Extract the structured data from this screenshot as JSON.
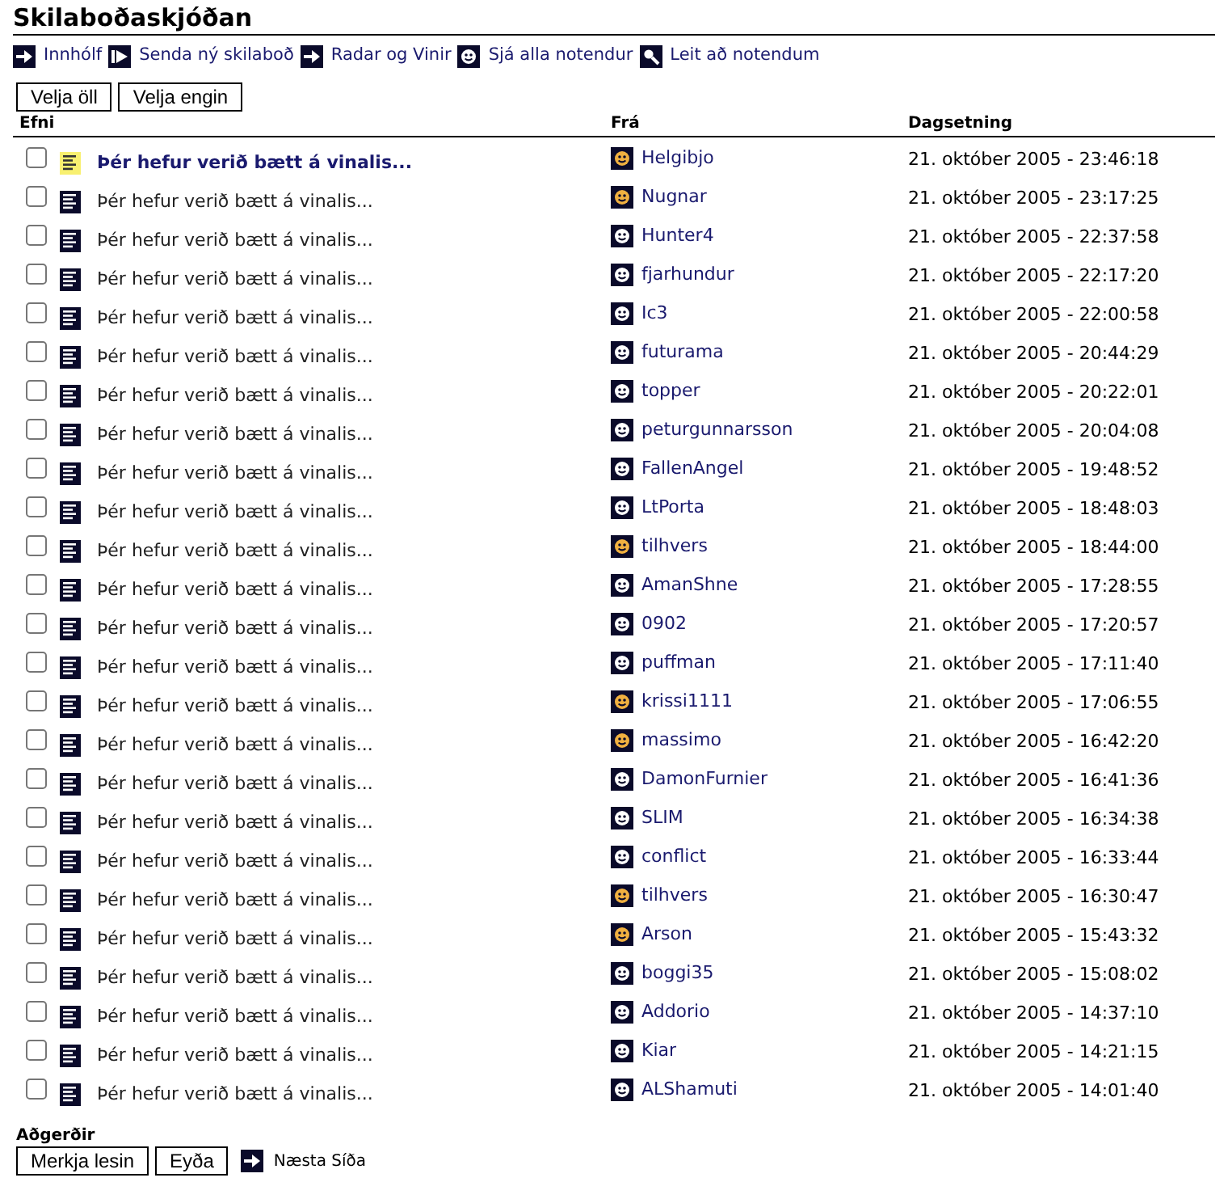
{
  "title": "Skilaboðaskjóðan",
  "nav": [
    {
      "kind": "arrow",
      "label": "Innhólf"
    },
    {
      "kind": "send",
      "label": "Senda ný skilaboð"
    },
    {
      "kind": "arrow",
      "label": "Radar og Vinir"
    },
    {
      "kind": "user",
      "label": "Sjá alla notendur"
    },
    {
      "kind": "search",
      "label": "Leit að notendum"
    }
  ],
  "select_buttons": [
    "Velja öll",
    "Velja engin"
  ],
  "columns": [
    "Efni",
    "Frá",
    "Dagsetning"
  ],
  "rows": [
    {
      "checked": false,
      "unread": true,
      "subject": "Þér hefur verið bætt á vinalis...",
      "from": "Helgibjo",
      "online": true,
      "date": "21. október 2005 - 23:46:18"
    },
    {
      "checked": false,
      "unread": false,
      "subject": "Þér hefur verið bætt á vinalis...",
      "from": "Nugnar",
      "online": true,
      "date": "21. október 2005 - 23:17:25"
    },
    {
      "checked": false,
      "unread": false,
      "subject": "Þér hefur verið bætt á vinalis...",
      "from": "Hunter4",
      "online": false,
      "date": "21. október 2005 - 22:37:58"
    },
    {
      "checked": false,
      "unread": false,
      "subject": "Þér hefur verið bætt á vinalis...",
      "from": "fjarhundur",
      "online": false,
      "date": "21. október 2005 - 22:17:20"
    },
    {
      "checked": false,
      "unread": false,
      "subject": "Þér hefur verið bætt á vinalis...",
      "from": "Ic3",
      "online": false,
      "date": "21. október 2005 - 22:00:58"
    },
    {
      "checked": false,
      "unread": false,
      "subject": "Þér hefur verið bætt á vinalis...",
      "from": "futurama",
      "online": false,
      "date": "21. október 2005 - 20:44:29"
    },
    {
      "checked": false,
      "unread": false,
      "subject": "Þér hefur verið bætt á vinalis...",
      "from": "topper",
      "online": false,
      "date": "21. október 2005 - 20:22:01"
    },
    {
      "checked": false,
      "unread": false,
      "subject": "Þér hefur verið bætt á vinalis...",
      "from": "peturgunnarsson",
      "online": false,
      "date": "21. október 2005 - 20:04:08"
    },
    {
      "checked": false,
      "unread": false,
      "subject": "Þér hefur verið bætt á vinalis...",
      "from": "FallenAngel",
      "online": false,
      "date": "21. október 2005 - 19:48:52"
    },
    {
      "checked": false,
      "unread": false,
      "subject": "Þér hefur verið bætt á vinalis...",
      "from": "LtPorta",
      "online": false,
      "date": "21. október 2005 - 18:48:03"
    },
    {
      "checked": false,
      "unread": false,
      "subject": "Þér hefur verið bætt á vinalis...",
      "from": "tilhvers",
      "online": true,
      "date": "21. október 2005 - 18:44:00"
    },
    {
      "checked": false,
      "unread": false,
      "subject": "Þér hefur verið bætt á vinalis...",
      "from": "AmanShne",
      "online": false,
      "date": "21. október 2005 - 17:28:55"
    },
    {
      "checked": false,
      "unread": false,
      "subject": "Þér hefur verið bætt á vinalis...",
      "from": "0902",
      "online": false,
      "date": "21. október 2005 - 17:20:57"
    },
    {
      "checked": false,
      "unread": false,
      "subject": "Þér hefur verið bætt á vinalis...",
      "from": "puffman",
      "online": false,
      "date": "21. október 2005 - 17:11:40"
    },
    {
      "checked": false,
      "unread": false,
      "subject": "Þér hefur verið bætt á vinalis...",
      "from": "krissi1111",
      "online": true,
      "date": "21. október 2005 - 17:06:55"
    },
    {
      "checked": false,
      "unread": false,
      "subject": "Þér hefur verið bætt á vinalis...",
      "from": "massimo",
      "online": true,
      "date": "21. október 2005 - 16:42:20"
    },
    {
      "checked": false,
      "unread": false,
      "subject": "Þér hefur verið bætt á vinalis...",
      "from": "DamonFurnier",
      "online": false,
      "date": "21. október 2005 - 16:41:36"
    },
    {
      "checked": false,
      "unread": false,
      "subject": "Þér hefur verið bætt á vinalis...",
      "from": "SLIM",
      "online": false,
      "date": "21. október 2005 - 16:34:38"
    },
    {
      "checked": false,
      "unread": false,
      "subject": "Þér hefur verið bætt á vinalis...",
      "from": "conflict",
      "online": false,
      "date": "21. október 2005 - 16:33:44"
    },
    {
      "checked": false,
      "unread": false,
      "subject": "Þér hefur verið bætt á vinalis...",
      "from": "tilhvers",
      "online": true,
      "date": "21. október 2005 - 16:30:47"
    },
    {
      "checked": false,
      "unread": false,
      "subject": "Þér hefur verið bætt á vinalis...",
      "from": "Arson",
      "online": true,
      "date": "21. október 2005 - 15:43:32"
    },
    {
      "checked": false,
      "unread": false,
      "subject": "Þér hefur verið bætt á vinalis...",
      "from": "boggi35",
      "online": false,
      "date": "21. október 2005 - 15:08:02"
    },
    {
      "checked": false,
      "unread": false,
      "subject": "Þér hefur verið bætt á vinalis...",
      "from": "Addorio",
      "online": false,
      "date": "21. október 2005 - 14:37:10"
    },
    {
      "checked": false,
      "unread": false,
      "subject": "Þér hefur verið bætt á vinalis...",
      "from": "Kiar",
      "online": false,
      "date": "21. október 2005 - 14:21:15"
    },
    {
      "checked": false,
      "unread": false,
      "subject": "Þér hefur verið bætt á vinalis...",
      "from": "ALShamuti",
      "online": false,
      "date": "21. október 2005 - 14:01:40"
    }
  ],
  "actions_label": "Aðgerðir",
  "action_buttons": [
    "Merkja lesin",
    "Eyða"
  ],
  "next_link": "Næsta Síða"
}
